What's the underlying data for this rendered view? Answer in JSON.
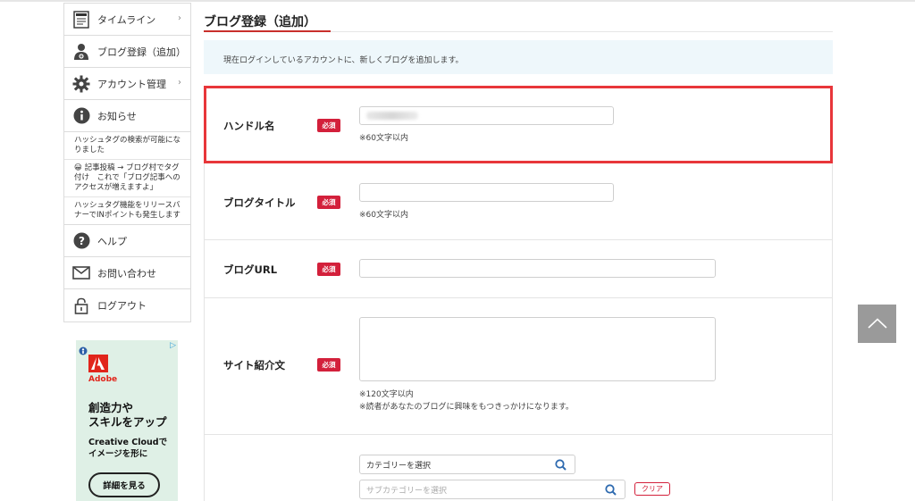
{
  "sidebar": {
    "items": [
      {
        "label": "タイムライン",
        "icon": "timeline-icon",
        "arrow": "›"
      },
      {
        "label": "ブログ登録（追加）",
        "icon": "user-add-icon"
      },
      {
        "label": "アカウント管理",
        "icon": "gear-icon",
        "arrow": "›"
      },
      {
        "label": "お知らせ",
        "icon": "info-icon"
      }
    ],
    "notices": [
      "ハッシュタグの検索が可能になりました",
      "😀 記事投稿 → ブログ村でタグ付け　これで「ブログ記事へのアクセスが増えますよ」",
      "ハッシュタグ機能をリリースバナーでINポイントも発生します"
    ],
    "bottom_items": [
      {
        "label": "ヘルプ",
        "icon": "help-icon"
      },
      {
        "label": "お問い合わせ",
        "icon": "mail-icon"
      },
      {
        "label": "ログアウト",
        "icon": "lock-icon"
      }
    ]
  },
  "ad": {
    "brand": "Adobe",
    "headline_1": "創造力や",
    "headline_2": "スキルをアップ",
    "sub_1": "Creative Cloudで",
    "sub_2": "イメージを形に",
    "button": "詳細を見る",
    "play_mark": "▷"
  },
  "main": {
    "title": "ブログ登録（追加）",
    "info": "現在ログインしているアカウントに、新しくブログを追加します。",
    "required_label": "必須",
    "fields": {
      "handle": {
        "label": "ハンドル名",
        "hint": "※60文字以内"
      },
      "blog_title": {
        "label": "ブログタイトル",
        "hint": "※60文字以内"
      },
      "blog_url": {
        "label": "ブログURL"
      },
      "description": {
        "label": "サイト紹介文",
        "hint_1": "※120文字以内",
        "hint_2": "※読者があなたのブログに興味をもつきっかけになります。"
      },
      "category": {
        "value": "カテゴリーを選択",
        "sub_placeholder": "サブカテゴリーを選択",
        "clear": "クリア"
      }
    }
  },
  "colors": {
    "accent_red": "#d3203b",
    "highlight_red": "#e8363a",
    "info_bg": "#eef7fb",
    "to_top_bg": "#9a9a9a"
  }
}
